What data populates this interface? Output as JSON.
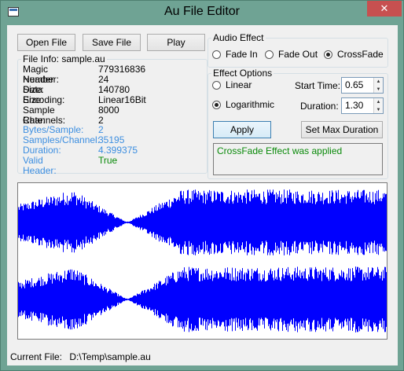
{
  "window": {
    "title": "Au File Editor",
    "close_glyph": "✕"
  },
  "toolbar": {
    "open_label": "Open File",
    "save_label": "Save File",
    "play_label": "Play"
  },
  "file_info": {
    "legend": "File Info: sample.au",
    "rows": [
      {
        "key": "Magic Number:",
        "value": "779316836",
        "style": "normal"
      },
      {
        "key": "Header Size:",
        "value": "24",
        "style": "normal"
      },
      {
        "key": "Data Size:",
        "value": "140780",
        "style": "normal"
      },
      {
        "key": "Encoding:",
        "value": "Linear16Bit",
        "style": "normal"
      },
      {
        "key": "Sample Rate:",
        "value": "8000",
        "style": "normal"
      },
      {
        "key": "Channels:",
        "value": "2",
        "style": "normal"
      },
      {
        "key": "Bytes/Sample:",
        "value": "2",
        "style": "blue"
      },
      {
        "key": "Samples/Channel:",
        "value": "35195",
        "style": "blue"
      },
      {
        "key": "Duration:",
        "value": "4.399375",
        "style": "blue"
      },
      {
        "key": "Valid Header:",
        "value": "True",
        "style": "green"
      }
    ]
  },
  "audio_effect": {
    "legend": "Audio Effect",
    "options": [
      {
        "label": "Fade In",
        "selected": false
      },
      {
        "label": "Fade Out",
        "selected": false
      },
      {
        "label": "CrossFade",
        "selected": true
      }
    ]
  },
  "effect_options": {
    "legend": "Effect Options",
    "linear_label": "Linear",
    "linear_selected": false,
    "log_label": "Logarithmic",
    "log_selected": true,
    "start_time_label": "Start Time:",
    "start_time_value": "0.65",
    "duration_label": "Duration:",
    "duration_value": "1.30",
    "apply_label": "Apply",
    "max_duration_label": "Set Max Duration"
  },
  "status_message": "CrossFade Effect was applied",
  "waveform": {
    "channels": 2,
    "color": "#0000ff",
    "crossfade_start": 0.65,
    "crossfade_duration": 1.3,
    "total_duration": 4.399375
  },
  "statusbar": {
    "label": "Current File:",
    "path": "D:\\Temp\\sample.au"
  }
}
